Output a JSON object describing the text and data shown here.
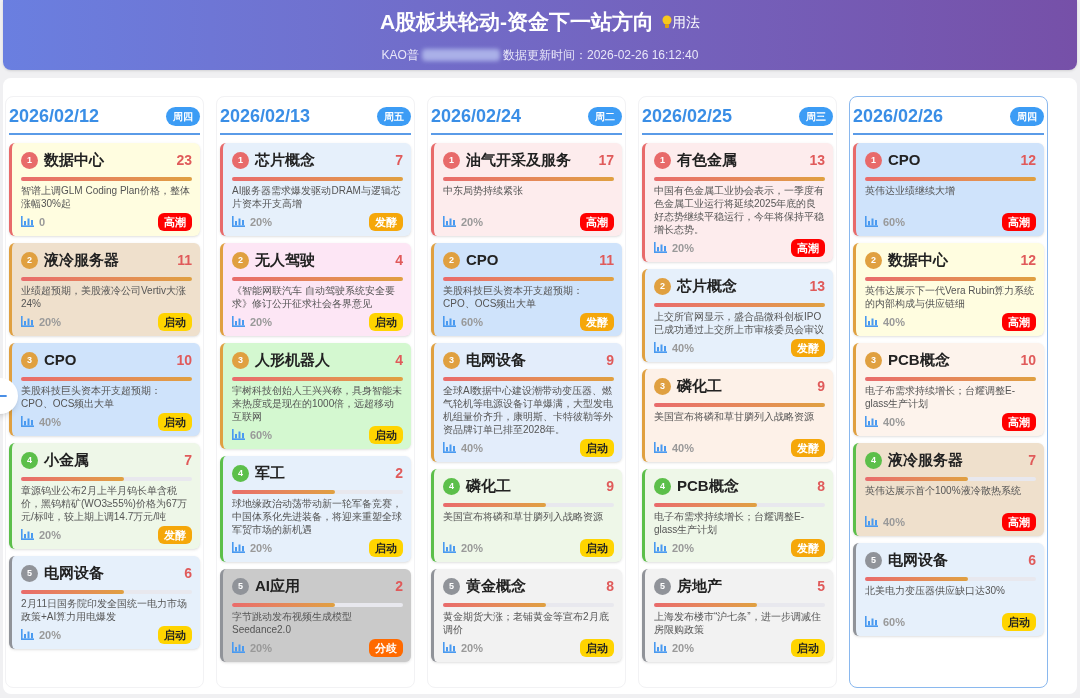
{
  "header": {
    "title": "A股板块轮动-资金下一站方向",
    "help_link": "用法",
    "subtitle_prefix": "KAO普",
    "update_time": "数据更新时间：2026-02-26 16:12:40"
  },
  "columns": [
    {
      "date": "2026/02/12",
      "weekday": "周四",
      "selected": false,
      "cards": [
        {
          "rank": "1",
          "name": "数据中心",
          "count": "23",
          "level": 1,
          "desc": "智谱上调GLM Coding Plan价格，整体涨幅30%起",
          "pct": "0",
          "stage": {
            "label": "高潮",
            "kind": "climax"
          },
          "color": "#fffde0"
        },
        {
          "rank": "2",
          "name": "液冷服务器",
          "count": "11",
          "level": 1,
          "desc": "业绩超预期，美股液冷公司Vertiv大涨24%",
          "pct": "20%",
          "stage": {
            "label": "启动",
            "kind": "start"
          },
          "color": "#efe0cc"
        },
        {
          "rank": "3",
          "name": "CPO",
          "count": "10",
          "level": 1,
          "desc": "美股科技巨头资本开支超预期：CPO、OCS频出大单",
          "pct": "40%",
          "stage": {
            "label": "启动",
            "kind": "start"
          },
          "color": "#cfe3fb"
        },
        {
          "rank": "4",
          "name": "小金属",
          "count": "7",
          "level": 0.6,
          "desc": "章源钨业公布2月上半月钨长单含税价，黑钨精矿(WO3≥55%)价格为67万元/标吨，较上期上调14.7万元/吨",
          "pct": "20%",
          "stage": {
            "label": "发酵",
            "kind": "ferment"
          },
          "color": "#eef7e8"
        },
        {
          "rank": "5",
          "name": "电网设备",
          "count": "6",
          "level": 0.6,
          "desc": "2月11日国务院印发全国统一电力市场政策+AI算力用电爆发",
          "pct": "20%",
          "stage": {
            "label": "启动",
            "kind": "start"
          },
          "color": "#e6f0fb"
        }
      ]
    },
    {
      "date": "2026/02/13",
      "weekday": "周五",
      "selected": false,
      "cards": [
        {
          "rank": "1",
          "name": "芯片概念",
          "count": "7",
          "level": 1,
          "desc": "AI服务器需求爆发驱动DRAM与逻辑芯片资本开支高增",
          "pct": "20%",
          "stage": {
            "label": "发酵",
            "kind": "ferment"
          },
          "color": "#e6f0fb"
        },
        {
          "rank": "2",
          "name": "无人驾驶",
          "count": "4",
          "level": 1,
          "desc": "《智能网联汽车 自动驾驶系统安全要求》修订公开征求社会各界意见",
          "pct": "20%",
          "stage": {
            "label": "启动",
            "kind": "start"
          },
          "color": "#fde6f5"
        },
        {
          "rank": "3",
          "name": "人形机器人",
          "count": "4",
          "level": 1,
          "desc": "宇树科技创始人王兴兴称，具身智能未来热度或是现在的1000倍，远超移动互联网",
          "pct": "60%",
          "stage": {
            "label": "启动",
            "kind": "start"
          },
          "color": "#d4f8d0"
        },
        {
          "rank": "4",
          "name": "军工",
          "count": "2",
          "level": 0.6,
          "desc": "球地缘政治动荡带动新一轮军备竞赛，中国体系化先进装备，将迎来重塑全球军贸市场的新机遇",
          "pct": "20%",
          "stage": {
            "label": "启动",
            "kind": "start"
          },
          "color": "#e6f0fb"
        },
        {
          "rank": "5",
          "name": "AI应用",
          "count": "2",
          "level": 0.6,
          "desc": "字节跳动发布视频生成模型Seedance2.0",
          "pct": "20%",
          "stage": {
            "label": "分歧",
            "kind": "diverge"
          },
          "color": "#cacaca"
        }
      ]
    },
    {
      "date": "2026/02/24",
      "weekday": "周二",
      "selected": false,
      "cards": [
        {
          "rank": "1",
          "name": "油气开采及服务",
          "count": "17",
          "level": 1,
          "desc": "中东局势持续紧张",
          "pct": "20%",
          "stage": {
            "label": "高潮",
            "kind": "climax"
          },
          "color": "#fdeced"
        },
        {
          "rank": "2",
          "name": "CPO",
          "count": "11",
          "level": 1,
          "desc": "美股科技巨头资本开支超预期：CPO、OCS频出大单",
          "pct": "60%",
          "stage": {
            "label": "发酵",
            "kind": "ferment"
          },
          "color": "#cfe3fb"
        },
        {
          "rank": "3",
          "name": "电网设备",
          "count": "9",
          "level": 1,
          "desc": "全球AI数据中心建设潮带动变压器、燃气轮机等电源设备订单爆满，大型发电机组量价齐升，康明斯、卡特彼勒等外资品牌订单已排至2028年。",
          "pct": "40%",
          "stage": {
            "label": "启动",
            "kind": "start"
          },
          "color": "#e3edfb"
        },
        {
          "rank": "4",
          "name": "磷化工",
          "count": "9",
          "level": 0.6,
          "desc": "美国宣布将磷和草甘膦列入战略资源",
          "pct": "20%",
          "stage": {
            "label": "启动",
            "kind": "start"
          },
          "color": "#eef7e8"
        },
        {
          "rank": "5",
          "name": "黄金概念",
          "count": "8",
          "level": 0.6,
          "desc": "黄金期货大涨；老铺黄金等宣布2月底调价",
          "pct": "20%",
          "stage": {
            "label": "启动",
            "kind": "start"
          },
          "color": "#f2f2f2"
        }
      ]
    },
    {
      "date": "2026/02/25",
      "weekday": "周三",
      "selected": false,
      "cards": [
        {
          "rank": "1",
          "name": "有色金属",
          "count": "13",
          "level": 1,
          "desc": "中国有色金属工业协会表示，一季度有色金属工业运行将延续2025年底的良好态势继续平稳运行，今年将保持平稳增长态势。",
          "pct": "20%",
          "stage": {
            "label": "高潮",
            "kind": "climax"
          },
          "color": "#fdeced"
        },
        {
          "rank": "2",
          "name": "芯片概念",
          "count": "13",
          "level": 1,
          "desc": "上交所官网显示，盛合晶微科创板IPO已成功通过上交所上市审核委员会审议",
          "pct": "40%",
          "stage": {
            "label": "发酵",
            "kind": "ferment"
          },
          "color": "#e6f0fb"
        },
        {
          "rank": "3",
          "name": "磷化工",
          "count": "9",
          "level": 1,
          "desc": "美国宣布将磷和草甘膦列入战略资源",
          "pct": "40%",
          "stage": {
            "label": "发酵",
            "kind": "ferment"
          },
          "color": "#fdf1e8"
        },
        {
          "rank": "4",
          "name": "PCB概念",
          "count": "8",
          "level": 0.6,
          "desc": "电子布需求持续增长；台耀调整E-glass生产计划",
          "pct": "20%",
          "stage": {
            "label": "发酵",
            "kind": "ferment"
          },
          "color": "#eef7e8"
        },
        {
          "rank": "5",
          "name": "房地产",
          "count": "5",
          "level": 0.6,
          "desc": "上海发布楼市“沪七条”，进一步调减住房限购政策",
          "pct": "20%",
          "stage": {
            "label": "启动",
            "kind": "start"
          },
          "color": "#f2f2f2"
        }
      ]
    },
    {
      "date": "2026/02/26",
      "weekday": "周四",
      "selected": true,
      "cards": [
        {
          "rank": "1",
          "name": "CPO",
          "count": "12",
          "level": 1,
          "desc": "英伟达业绩继续大增",
          "pct": "60%",
          "stage": {
            "label": "高潮",
            "kind": "climax"
          },
          "color": "#cfe3fb"
        },
        {
          "rank": "2",
          "name": "数据中心",
          "count": "12",
          "level": 1,
          "desc": "英伟达展示下一代Vera Rubin算力系统的内部构成与供应链细",
          "pct": "40%",
          "stage": {
            "label": "高潮",
            "kind": "climax"
          },
          "color": "#fffde0"
        },
        {
          "rank": "3",
          "name": "PCB概念",
          "count": "10",
          "level": 1,
          "desc": "电子布需求持续增长；台耀调整E-glass生产计划",
          "pct": "40%",
          "stage": {
            "label": "高潮",
            "kind": "climax"
          },
          "color": "#fdf3ec"
        },
        {
          "rank": "4",
          "name": "液冷服务器",
          "count": "7",
          "level": 0.6,
          "desc": "英伟达展示首个100%液冷散热系统",
          "pct": "40%",
          "stage": {
            "label": "高潮",
            "kind": "climax"
          },
          "color": "#efe0cc"
        },
        {
          "rank": "5",
          "name": "电网设备",
          "count": "6",
          "level": 0.6,
          "desc": "北美电力变压器供应缺口达30%",
          "pct": "60%",
          "stage": {
            "label": "启动",
            "kind": "start"
          },
          "color": "#e6f0fb"
        }
      ]
    }
  ]
}
